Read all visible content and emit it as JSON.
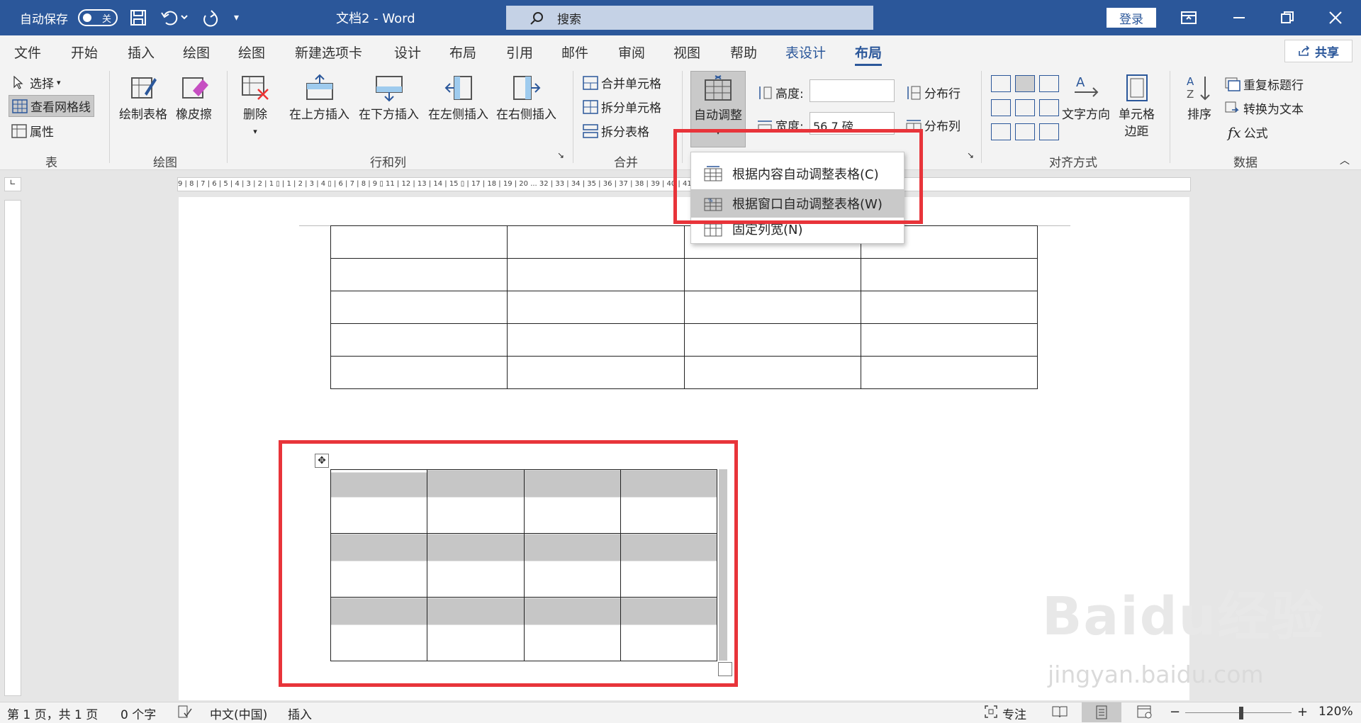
{
  "titlebar": {
    "autosave_label": "自动保存",
    "autosave_state": "关",
    "doc_title": "文档2  -  Word",
    "search_placeholder": "搜索",
    "login_label": "登录"
  },
  "tabs": [
    "文件",
    "开始",
    "插入",
    "绘图",
    "绘图",
    "新建选项卡",
    "设计",
    "布局",
    "引用",
    "邮件",
    "审阅",
    "视图",
    "帮助",
    "表设计",
    "布局"
  ],
  "share_label": "共享",
  "ribbon": {
    "table_group": {
      "select": "选择",
      "gridlines": "查看网格线",
      "properties": "属性",
      "label": "表"
    },
    "draw_group": {
      "draw_table": "绘制表格",
      "eraser": "橡皮擦",
      "label": "绘图"
    },
    "rowcol_group": {
      "delete": "删除",
      "insert_above": "在上方插入",
      "insert_below": "在下方插入",
      "insert_left": "在左侧插入",
      "insert_right": "在右侧插入",
      "label": "行和列"
    },
    "merge_group": {
      "merge_cells": "合并单元格",
      "split_cells": "拆分单元格",
      "split_table": "拆分表格",
      "label": "合并"
    },
    "autofit": "自动调整",
    "cellsize": {
      "height_label": "高度:",
      "width_label": "宽度:",
      "width_value": "56.7 磅",
      "distribute_rows": "分布行",
      "distribute_cols": "分布列"
    },
    "align_group": {
      "text_direction": "文字方向",
      "cell_margins_1": "单元格",
      "cell_margins_2": "边距",
      "label": "对齐方式"
    },
    "data_group": {
      "sort": "排序",
      "repeat_header": "重复标题行",
      "convert_text": "转换为文本",
      "formula": "公式",
      "label": "数据"
    }
  },
  "autofit_menu": [
    {
      "label": "根据内容自动调整表格(C)"
    },
    {
      "label": "根据窗口自动调整表格(W)"
    },
    {
      "label": "固定列宽(N)"
    }
  ],
  "ruler_text": "9 | 8 | 7 | 6 | 5 | 4 | 3 | 2 | 1 ▯ | 1 | 2 | 3 | 4 ▯ | 6 | 7 | 8 | 9 ▯ 11 | 12 | 13 | 14 | 15 ▯ | 17 | 18 | 19 | 20 ... 32 | 33 | 34 | 35 | 36 | 37 | 38 | 39 | 40 | 41 | 42 | 43 | 44 | 45 | 46 | 47 |",
  "status": {
    "page": "第 1 页，共 1 页",
    "words": "0 个字",
    "language": "中文(中国)",
    "mode": "插入",
    "focus": "专注",
    "zoom": "120%"
  },
  "watermark": {
    "brand": "Baidu经验",
    "url": "jingyan.baidu.com"
  },
  "colors": {
    "word_blue": "#2b579a",
    "highlight_red": "#e8343a"
  }
}
